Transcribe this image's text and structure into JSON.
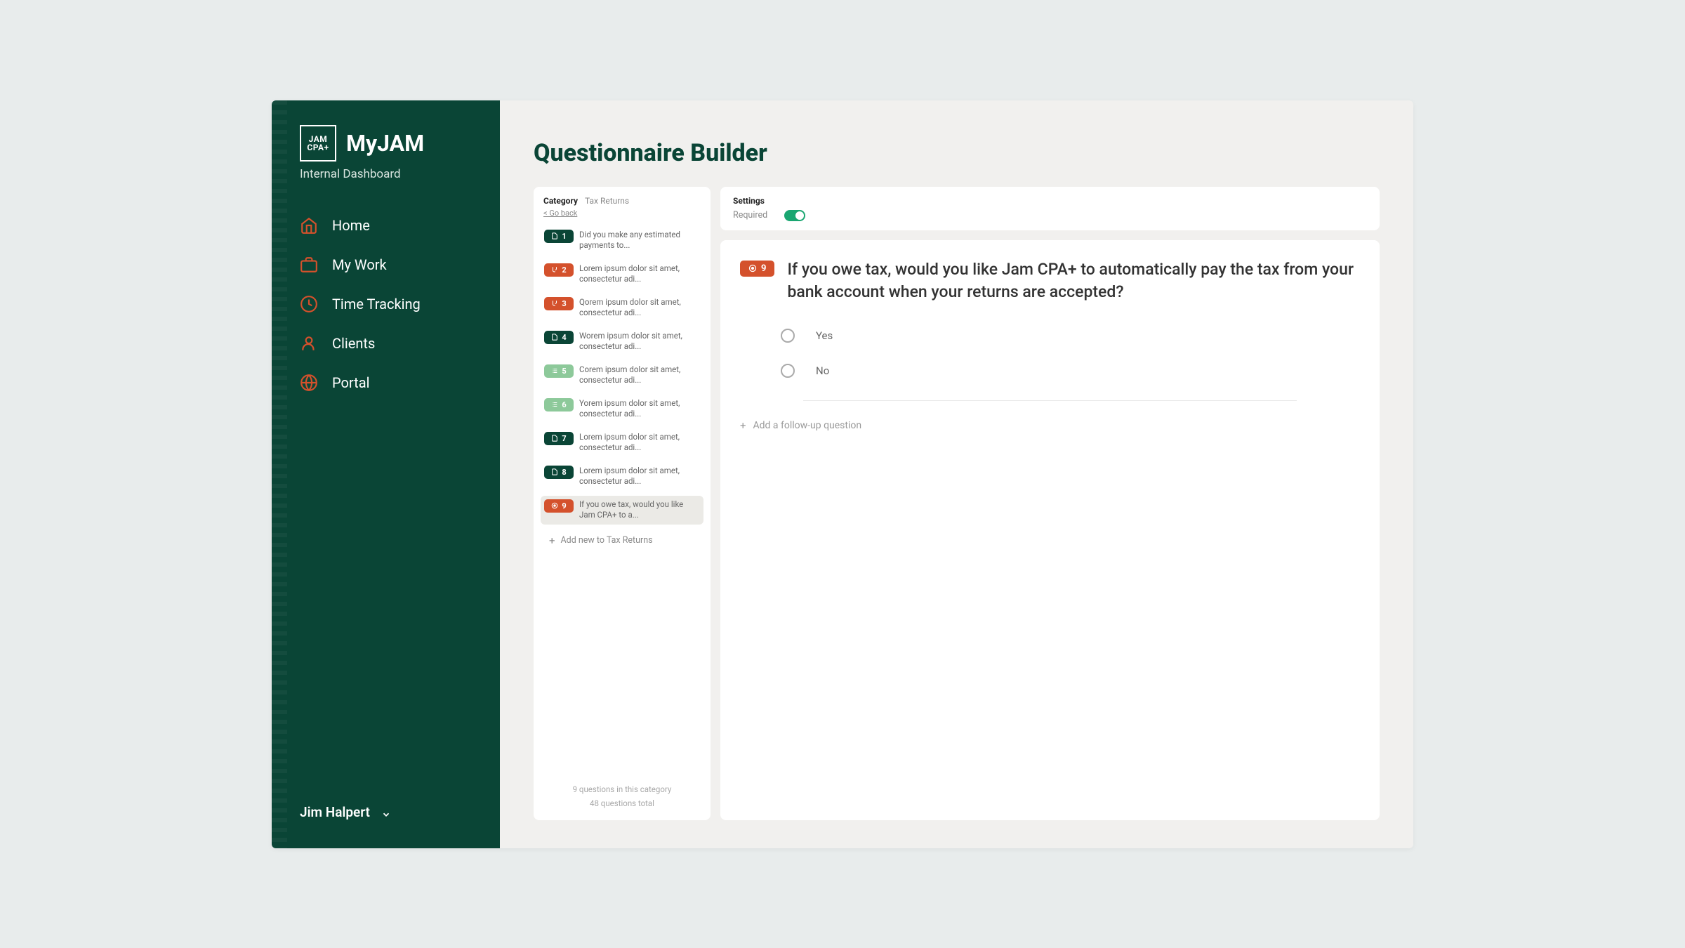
{
  "brand": {
    "logo_line1": "JAM",
    "logo_line2": "CPA+",
    "name": "MyJAM",
    "subtitle": "Internal Dashboard"
  },
  "nav": {
    "items": [
      {
        "label": "Home"
      },
      {
        "label": "My Work"
      },
      {
        "label": "Time Tracking"
      },
      {
        "label": "Clients"
      },
      {
        "label": "Portal"
      }
    ]
  },
  "user": {
    "name": "Jim Halpert"
  },
  "page": {
    "title": "Questionnaire Builder"
  },
  "list": {
    "header_label": "Category",
    "header_value": "Tax Returns",
    "go_back": "< Go back",
    "items": [
      {
        "num": "1",
        "color": "dark",
        "text": "Did you make any estimated payments to..."
      },
      {
        "num": "2",
        "color": "orange",
        "text": "Lorem ipsum dolor sit amet, consectetur adi..."
      },
      {
        "num": "3",
        "color": "orange",
        "text": "Qorem ipsum dolor sit amet, consectetur adi..."
      },
      {
        "num": "4",
        "color": "dark",
        "text": "Worem ipsum dolor sit amet, consectetur adi..."
      },
      {
        "num": "5",
        "color": "light",
        "text": "Corem ipsum dolor sit amet, consectetur adi..."
      },
      {
        "num": "6",
        "color": "light",
        "text": "Yorem ipsum dolor sit amet, consectetur adi..."
      },
      {
        "num": "7",
        "color": "dark",
        "text": "Lorem ipsum dolor sit amet, consectetur adi..."
      },
      {
        "num": "8",
        "color": "dark",
        "text": "Lorem ipsum dolor sit amet, consectetur adi..."
      },
      {
        "num": "9",
        "color": "orange",
        "text": "If you owe tax, would you like Jam CPA+ to a..."
      }
    ],
    "add_new": "Add new to Tax Returns",
    "footer_line1": "9 questions in this category",
    "footer_line2": "48 questions total"
  },
  "settings": {
    "title": "Settings",
    "required_label": "Required"
  },
  "detail": {
    "badge_num": "9",
    "question": "If you owe tax, would you like Jam CPA+ to automatically pay the tax from your bank account when your returns are accepted?",
    "options": [
      {
        "label": "Yes"
      },
      {
        "label": "No"
      }
    ],
    "add_followup": "Add a follow-up question"
  }
}
